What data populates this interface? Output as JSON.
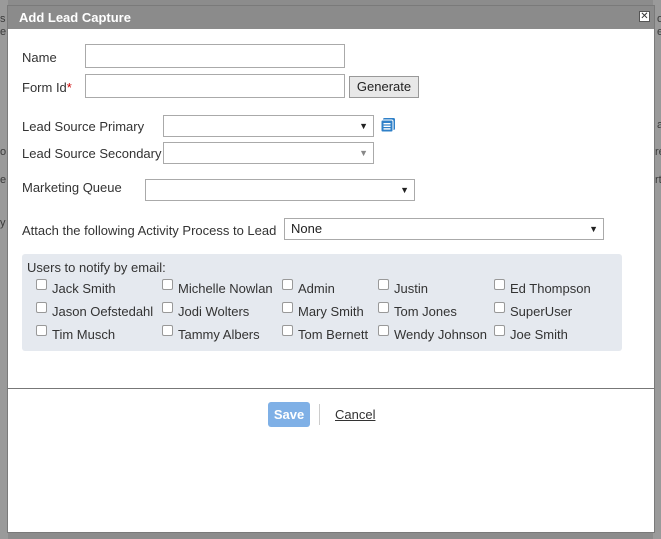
{
  "dialog": {
    "title": "Add Lead Capture",
    "close_glyph": "✕"
  },
  "form": {
    "name_label": "Name",
    "name_value": "",
    "form_id_label": "Form Id",
    "required_mark": "*",
    "form_id_value": "",
    "generate_label": "Generate",
    "lead_source_primary_label": "Lead Source Primary",
    "lead_source_primary_value": "",
    "lead_source_secondary_label": "Lead Source Secondary",
    "lead_source_secondary_value": "",
    "marketing_queue_label": "Marketing Queue",
    "marketing_queue_value": "",
    "activity_process_label": "Attach the following Activity Process to Lead",
    "activity_process_value": "None",
    "dropdown_arrow": "▼"
  },
  "notify": {
    "title": "Users to notify by email:",
    "users": [
      "Jack Smith",
      "Michelle Nowlan",
      "Admin",
      "Justin",
      "Ed Thompson",
      "Jason Oefstedahl",
      "Jodi Wolters",
      "Mary Smith",
      "Tom Jones",
      "SuperUser",
      "Tim Musch",
      "Tammy Albers",
      "Tom Bernett",
      "Wendy Johnson",
      "Joe Smith"
    ]
  },
  "footer": {
    "save_label": "Save",
    "cancel_label": "Cancel"
  },
  "background_fragments": [
    "s",
    "e",
    "o",
    "e",
    "a",
    "o",
    "re",
    "e",
    "rt",
    "y"
  ],
  "colors": {
    "titlebar": "#8b8b8b",
    "save_button": "#7fb0e6",
    "notify_panel": "#e5e9ef",
    "list_icon": "#2f80c8"
  }
}
